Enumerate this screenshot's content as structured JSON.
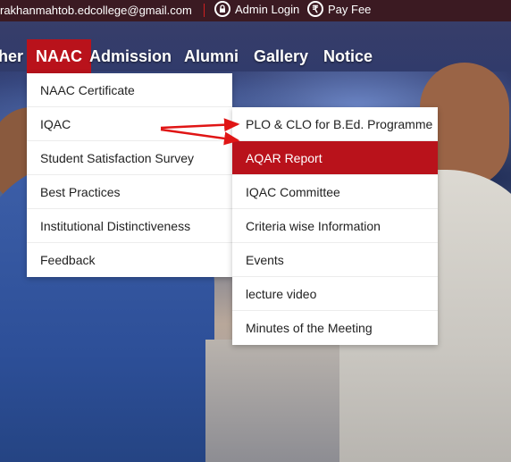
{
  "topbar": {
    "email": "rakhanmahtob.edcollege@gmail.com",
    "admin_label": "Admin Login",
    "fee_label": "Pay Fee",
    "fee_symbol": "₹"
  },
  "nav": {
    "prev_partial": "her",
    "naac": "NAAC",
    "admission": "Admission",
    "alumni": "Alumni",
    "gallery": "Gallery",
    "notice": "Notice"
  },
  "naac_menu": [
    "NAAC Certificate",
    "IQAC",
    "Student Satisfaction Survey",
    "Best Practices",
    "Institutional Distinctiveness",
    "Feedback"
  ],
  "iqac_menu": [
    "PLO & CLO for B.Ed. Programme",
    "AQAR Report",
    "IQAC Committee",
    "Criteria wise Information",
    "Events",
    "lecture video",
    "Minutes of the Meeting"
  ],
  "colors": {
    "accent": "#b9121b",
    "arrow": "#e01515"
  }
}
